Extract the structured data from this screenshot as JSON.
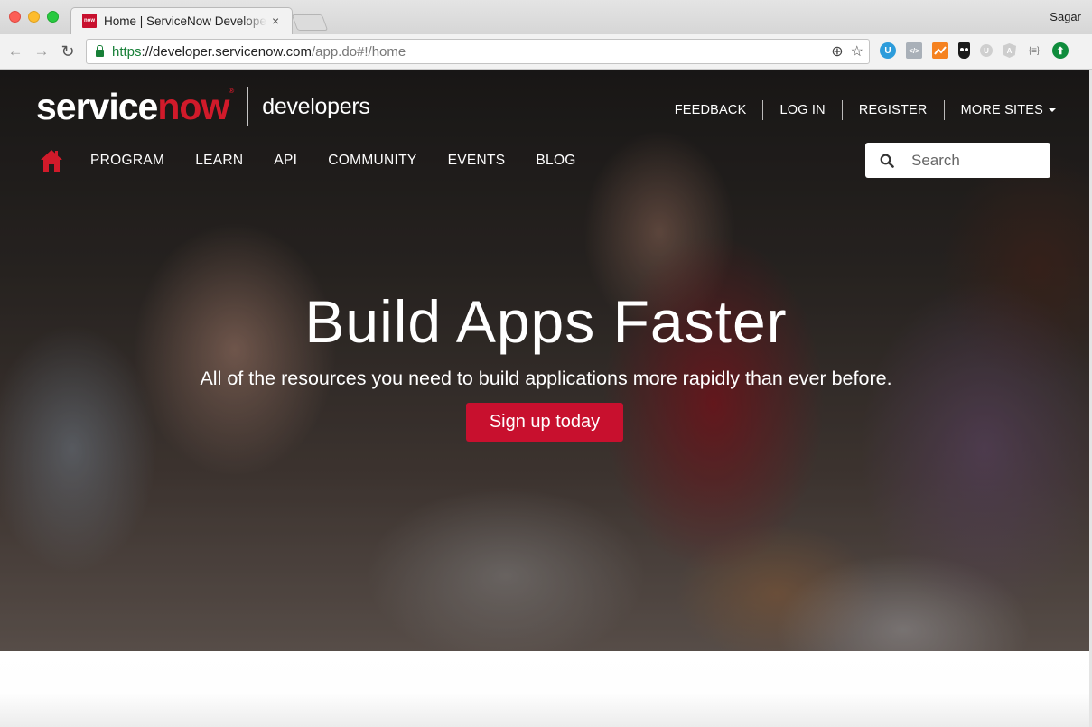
{
  "browser": {
    "tab": {
      "favicon_text": "now",
      "title": "Home | ServiceNow Developers",
      "close_glyph": "×"
    },
    "profile_name": "Sagar",
    "nav": {
      "back_glyph": "←",
      "forward_glyph": "→",
      "reload_glyph": "↻"
    },
    "url": {
      "scheme": "https",
      "separator": "://",
      "host": "developer.servicenow.com",
      "path": "/app.do#!/home"
    },
    "omnibox_icons": {
      "zoom_glyph": "⊕",
      "bookmark_glyph": "☆"
    },
    "extensions": [
      {
        "name": "u-extension",
        "glyph": "U"
      },
      {
        "name": "code-extension",
        "glyph": "</>"
      },
      {
        "name": "analytics-extension",
        "glyph": ""
      },
      {
        "name": "owl-extension",
        "glyph": ""
      },
      {
        "name": "u-grey-extension",
        "glyph": "U"
      },
      {
        "name": "angular-extension",
        "glyph": "A"
      },
      {
        "name": "json-extension",
        "glyph": "{≡}"
      },
      {
        "name": "upload-extension",
        "glyph": "⬆"
      }
    ]
  },
  "site": {
    "logo": {
      "part1": "service",
      "part2": "now",
      "reg": "®"
    },
    "brand_sub": "developers",
    "utility_nav": [
      {
        "label": "FEEDBACK"
      },
      {
        "label": "LOG IN"
      },
      {
        "label": "REGISTER"
      },
      {
        "label": "MORE SITES"
      }
    ],
    "main_nav": [
      {
        "label": "PROGRAM"
      },
      {
        "label": "LEARN"
      },
      {
        "label": "API"
      },
      {
        "label": "COMMUNITY"
      },
      {
        "label": "EVENTS"
      },
      {
        "label": "BLOG"
      }
    ],
    "search": {
      "placeholder": "Search",
      "value": ""
    },
    "hero": {
      "title": "Build Apps Faster",
      "subtitle": "All of the resources you need to build applications more rapidly than ever before.",
      "cta_label": "Sign up today"
    },
    "colors": {
      "brand_red": "#c8102e",
      "link_white": "#ffffff"
    }
  }
}
